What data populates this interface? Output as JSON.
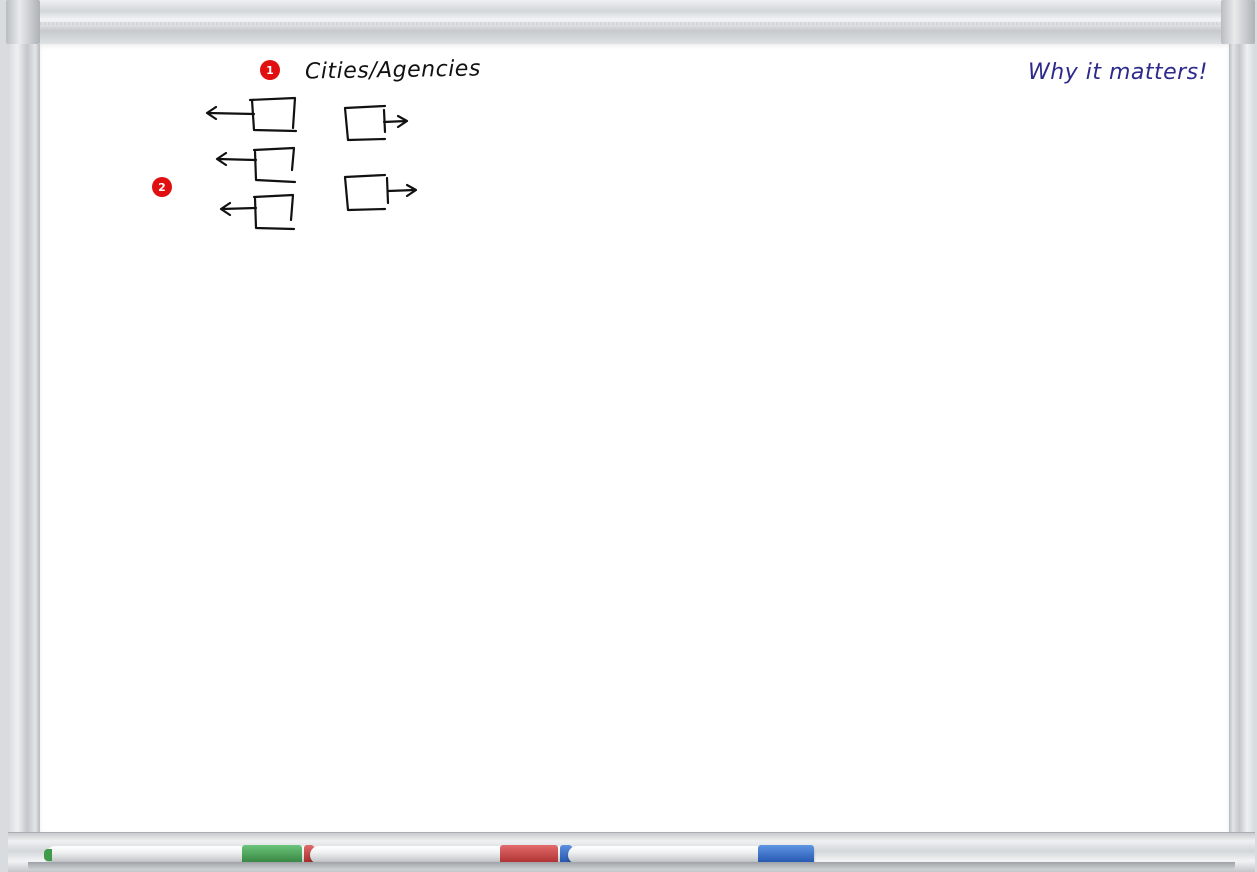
{
  "board": {
    "title": "Cities/Agencies",
    "subtitle": "Why it matters!",
    "badges": [
      {
        "label": "1",
        "color": "#e01010"
      },
      {
        "label": "2",
        "color": "#e01010"
      }
    ],
    "ink_colors": {
      "black": "#111111",
      "blue": "#2d2a8c"
    }
  },
  "tray": {
    "markers": [
      {
        "name": "green-marker",
        "color": "#3f9a4a"
      },
      {
        "name": "red-marker",
        "color": "#c23a3a"
      },
      {
        "name": "blue-marker",
        "color": "#2f68c4"
      }
    ]
  }
}
